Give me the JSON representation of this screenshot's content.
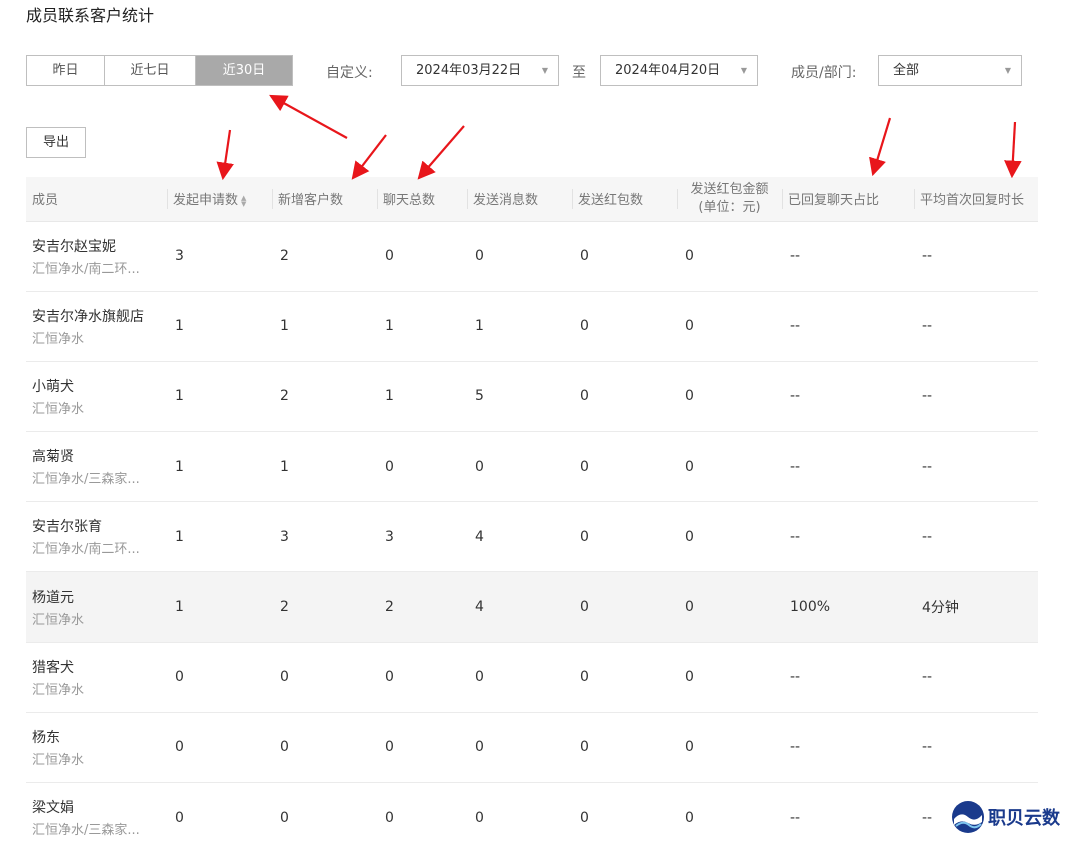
{
  "page": {
    "title": "成员联系客户统计"
  },
  "filters": {
    "range_buttons": [
      {
        "label": "昨日",
        "active": false
      },
      {
        "label": "近七日",
        "active": false
      },
      {
        "label": "近30日",
        "active": true
      }
    ],
    "custom_label": "自定义:",
    "start_date": "2024年03月22日",
    "to_label": "至",
    "end_date": "2024年04月20日",
    "member_label": "成员/部门:",
    "member_value": "全部"
  },
  "toolbar": {
    "export_label": "导出"
  },
  "table": {
    "columns": [
      "成员",
      "发起申请数",
      "新增客户数",
      "聊天总数",
      "发送消息数",
      "发送红包数",
      "发送红包金额\n(单位：元)",
      "已回复聊天占比",
      "平均首次回复时长"
    ],
    "rows": [
      {
        "name": "安吉尔赵宝妮",
        "dept": "汇恒净水/南二环...",
        "values": [
          "3",
          "2",
          "0",
          "0",
          "0",
          "0",
          "--",
          "--"
        ]
      },
      {
        "name": "安吉尔净水旗舰店",
        "dept": "汇恒净水",
        "values": [
          "1",
          "1",
          "1",
          "1",
          "0",
          "0",
          "--",
          "--"
        ]
      },
      {
        "name": "小萌犬",
        "dept": "汇恒净水",
        "values": [
          "1",
          "2",
          "1",
          "5",
          "0",
          "0",
          "--",
          "--"
        ]
      },
      {
        "name": "高菊贤",
        "dept": "汇恒净水/三森家...",
        "values": [
          "1",
          "1",
          "0",
          "0",
          "0",
          "0",
          "--",
          "--"
        ]
      },
      {
        "name": "安吉尔张育",
        "dept": "汇恒净水/南二环...",
        "values": [
          "1",
          "3",
          "3",
          "4",
          "0",
          "0",
          "--",
          "--"
        ]
      },
      {
        "name": "杨道元",
        "dept": "汇恒净水",
        "values": [
          "1",
          "2",
          "2",
          "4",
          "0",
          "0",
          "100%",
          "4分钟"
        ]
      },
      {
        "name": "猎客犬",
        "dept": "汇恒净水",
        "values": [
          "0",
          "0",
          "0",
          "0",
          "0",
          "0",
          "--",
          "--"
        ]
      },
      {
        "name": "杨东",
        "dept": "汇恒净水",
        "values": [
          "0",
          "0",
          "0",
          "0",
          "0",
          "0",
          "--",
          "--"
        ]
      },
      {
        "name": "梁文娟",
        "dept": "汇恒净水/三森家...",
        "values": [
          "0",
          "0",
          "0",
          "0",
          "0",
          "0",
          "--",
          "--"
        ]
      }
    ],
    "highlighted_row": 5
  },
  "watermark": {
    "text": "职贝云数"
  },
  "colors": {
    "active_segment": "#a9a9a9",
    "arrow": "#e8161b",
    "header_bg": "#f6f6f6",
    "highlight_row": "#f4f4f4",
    "watermark": "#1a3a8c"
  }
}
